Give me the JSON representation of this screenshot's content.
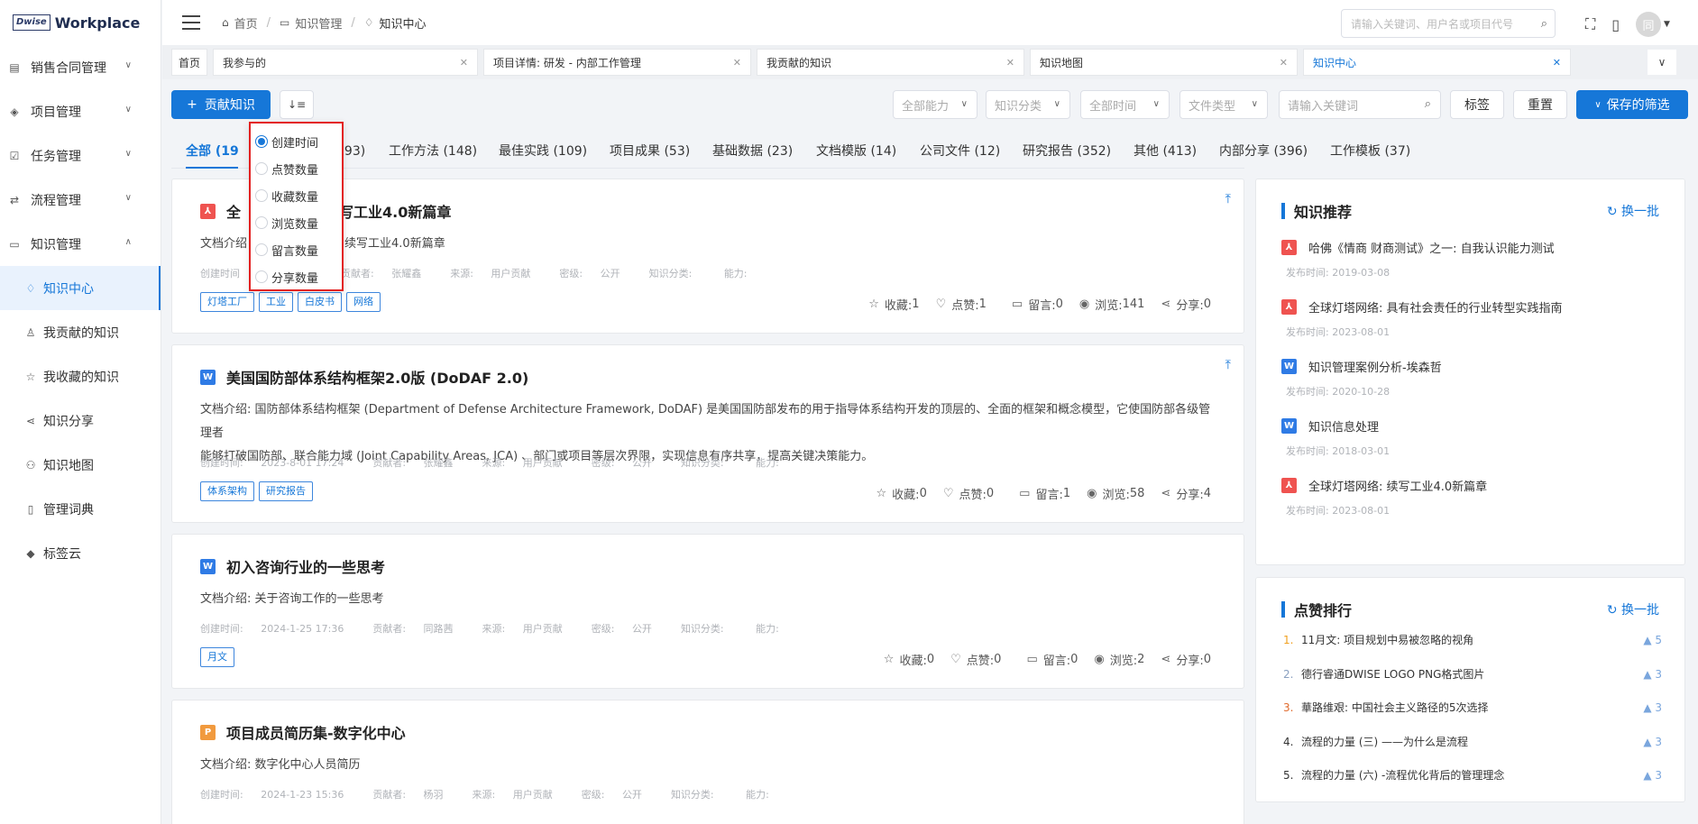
{
  "app": {
    "logo_mark": "Dwise",
    "logo_text": "Workplace"
  },
  "sidebar": {
    "items": [
      {
        "label": "销售合同管理"
      },
      {
        "label": "项目管理"
      },
      {
        "label": "任务管理"
      },
      {
        "label": "流程管理"
      },
      {
        "label": "知识管理"
      }
    ],
    "sub_items": [
      {
        "label": "知识中心"
      },
      {
        "label": "我贡献的知识"
      },
      {
        "label": "我收藏的知识"
      },
      {
        "label": "知识分享"
      },
      {
        "label": "知识地图"
      },
      {
        "label": "管理词典"
      },
      {
        "label": "标签云"
      }
    ]
  },
  "header": {
    "breadcrumb": [
      "首页",
      "知识管理",
      "知识中心"
    ],
    "search_placeholder": "请输入关键词、用户名或项目代号",
    "avatar": "同"
  },
  "tabs": [
    {
      "label": "首页"
    },
    {
      "label": "我参与的"
    },
    {
      "label": "项目详情: 研发 - 内部工作管理"
    },
    {
      "label": "我贡献的知识"
    },
    {
      "label": "知识地图"
    },
    {
      "label": "知识中心"
    }
  ],
  "toolbar": {
    "contribute": "贡献知识",
    "filters": [
      "全部能力",
      "知识分类",
      "全部时间",
      "文件类型"
    ],
    "keyword_placeholder": "请输入关键词",
    "tag_btn": "标签",
    "reset_btn": "重置",
    "save_btn": "保存的筛选"
  },
  "categories": [
    "全部 (1930)",
    "293)",
    "工作方法 (148)",
    "最佳实践 (109)",
    "项目成果 (53)",
    "基础数据 (23)",
    "文档模版 (14)",
    "公司文件 (12)",
    "研究报告 (352)",
    "其他 (413)",
    "内部分享 (396)",
    "工作模板 (37)"
  ],
  "sort_menu": {
    "options": [
      "创建时间",
      "点赞数量",
      "收藏数量",
      "浏览数量",
      "留言数量",
      "分享数量"
    ],
    "selected": "创建时间"
  },
  "labels": {
    "intro": "文档介绍: ",
    "created": "创建时间: ",
    "contributor": "贡献者: ",
    "source": "来源: ",
    "secret": "密级: ",
    "category": "知识分类: ",
    "ability": "能力: ",
    "fav": "收藏: ",
    "like": "点赞: ",
    "comment": "留言: ",
    "view": "浏览: ",
    "share": "分享: "
  },
  "cards": [
    {
      "icon": "pdf",
      "title_left": "全",
      "title_right": "续写工业4.0新篇章",
      "intro_left": "文档介绍",
      "intro_right": "续写工业4.0新篇章",
      "created_left": "创建时间",
      "contributor": "张耀鑫",
      "source": "用户贡献",
      "secret": "公开",
      "tags": [
        "灯塔工厂",
        "工业",
        "白皮书",
        "网络"
      ],
      "fav": "1",
      "like": "1",
      "comment": "0",
      "view": "141",
      "share": "0"
    },
    {
      "icon": "word",
      "title": "美国国防部体系结构框架2.0版 (DoDAF 2.0)",
      "intro_line1": "国防部体系结构框架 (Department of Defense Architecture Framework, DoDAF) 是美国国防部发布的用于指导体系结构开发的顶层的、全面的框架和概念模型，它使国防部各级管理者",
      "intro_line2": "能够打破国防部、联合能力域 (Joint Capability Areas, JCA) 、部门或项目等层次界限，实现信息有序共享，提高关键决策能力。",
      "created": "2023-8-01 17:24",
      "contributor": "张耀鑫",
      "source": "用户贡献",
      "secret": "公开",
      "tags": [
        "体系架构",
        "研究报告"
      ],
      "fav": "0",
      "like": "0",
      "comment": "1",
      "view": "58",
      "share": "4"
    },
    {
      "icon": "word",
      "title": "初入咨询行业的一些思考",
      "intro": "关于咨询工作的一些思考",
      "created": "2024-1-25 17:36",
      "contributor": "同路茜",
      "source": "用户贡献",
      "secret": "公开",
      "tags": [
        "月文"
      ],
      "fav": "0",
      "like": "0",
      "comment": "0",
      "view": "2",
      "share": "0"
    },
    {
      "icon": "ppt",
      "title": "项目成员简历集-数字化中心",
      "intro": "数字化中心人员简历",
      "created": "2024-1-23 15:36",
      "contributor": "杨羽",
      "source": "用户贡献",
      "secret": "公开"
    }
  ],
  "recommend": {
    "title": "知识推荐",
    "refresh": "换一批",
    "date_label": "发布时间: ",
    "items": [
      {
        "icon": "pdf",
        "title": "哈佛《情商 财商测试》之一: 自我认识能力测试",
        "date": "2019-03-08"
      },
      {
        "icon": "pdf",
        "title": "全球灯塔网络: 具有社会责任的行业转型实践指南",
        "date": "2023-08-01"
      },
      {
        "icon": "word",
        "title": "知识管理案例分析-埃森哲",
        "date": "2020-10-28"
      },
      {
        "icon": "word",
        "title": "知识信息处理",
        "date": "2018-03-01"
      },
      {
        "icon": "pdf",
        "title": "全球灯塔网络: 续写工业4.0新篇章",
        "date": "2023-08-01"
      }
    ]
  },
  "ranking": {
    "title": "点赞排行",
    "refresh": "换一批",
    "items": [
      {
        "no": "1.",
        "title": "11月文: 项目规划中易被忽略的视角",
        "likes": "5",
        "color": "#f0a020"
      },
      {
        "no": "2.",
        "title": "德行睿通DWISE LOGO PNG格式图片",
        "likes": "3",
        "color": "#8aa0c0"
      },
      {
        "no": "3.",
        "title": "華路维艰: 中国社会主义路径的5次选择",
        "likes": "3",
        "color": "#e06a2c"
      },
      {
        "no": "4.",
        "title": "流程的力量 (三) ——为什么是流程",
        "likes": "3",
        "color": "#333333"
      },
      {
        "no": "5.",
        "title": "流程的力量 (六) -流程优化背后的管理理念",
        "likes": "3",
        "color": "#333333"
      }
    ]
  }
}
